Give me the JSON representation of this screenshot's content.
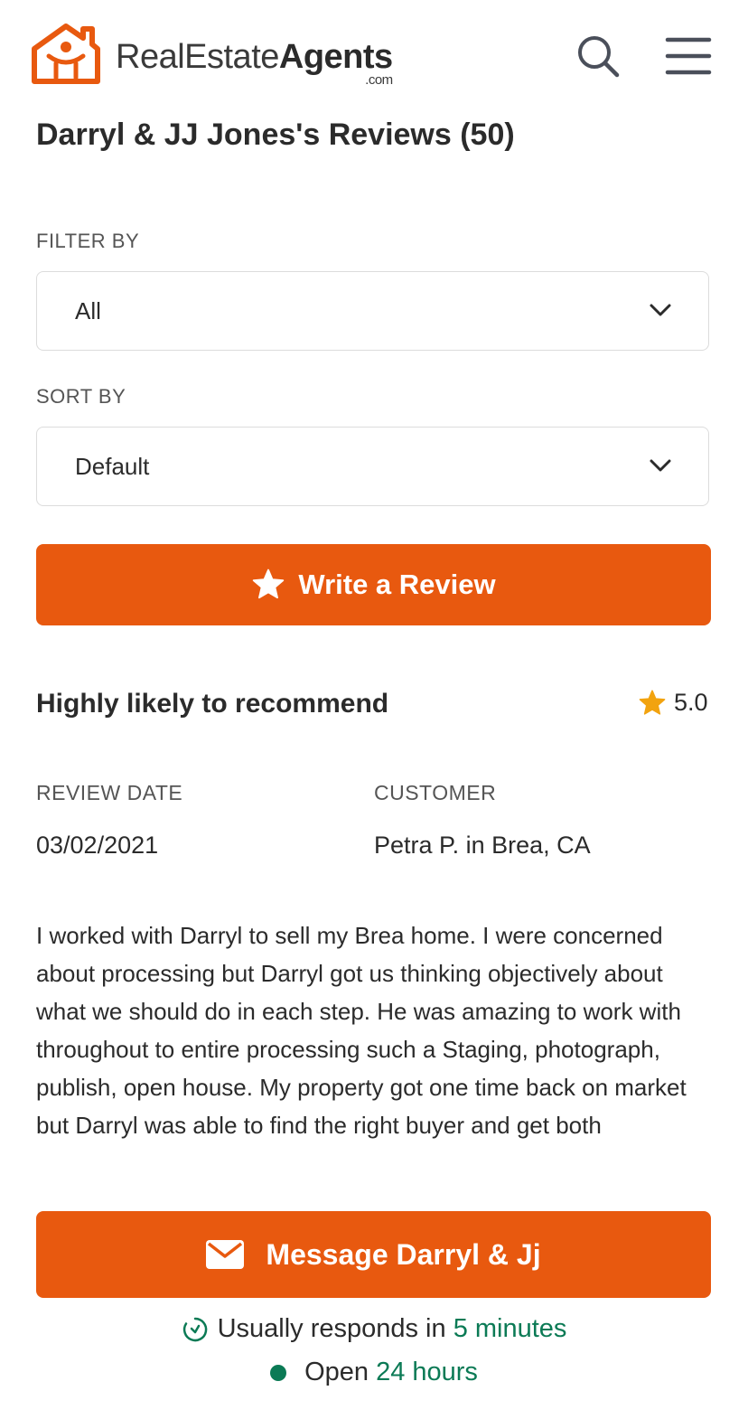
{
  "header": {
    "logo_text_light": "RealEstate",
    "logo_text_bold": "Agents",
    "logo_suffix": ".com",
    "icons": [
      "house-logo-icon",
      "search-icon",
      "hamburger-menu-icon"
    ]
  },
  "page_title": "Darryl & JJ Jones's Reviews (50)",
  "filter": {
    "label": "FILTER BY",
    "value": "All"
  },
  "sort": {
    "label": "SORT BY",
    "value": "Default"
  },
  "write_review_label": "Write a Review",
  "review": {
    "headline": "Highly likely to recommend",
    "rating": "5.0",
    "date_label": "REVIEW DATE",
    "date": "03/02/2021",
    "customer_label": "CUSTOMER",
    "customer": "Petra P. in Brea, CA",
    "body": "I worked with Darryl to sell my Brea home. I were concerned about processing but Darryl got us thinking objectively about what we should do in each step. He was amazing to work with throughout to entire processing such a Staging, photograph, publish, open house. My property got one time back on market but Darryl was able to find the right buyer and get both"
  },
  "footer": {
    "message_label": "Message Darryl & Jj",
    "responds_prefix": "Usually responds in",
    "responds_time": "5 minutes",
    "open_prefix": "Open",
    "open_hours": "24 hours"
  },
  "colors": {
    "brand_orange": "#e8590f",
    "accent_green": "#0b7a55",
    "star_gold": "#f2a30f"
  }
}
